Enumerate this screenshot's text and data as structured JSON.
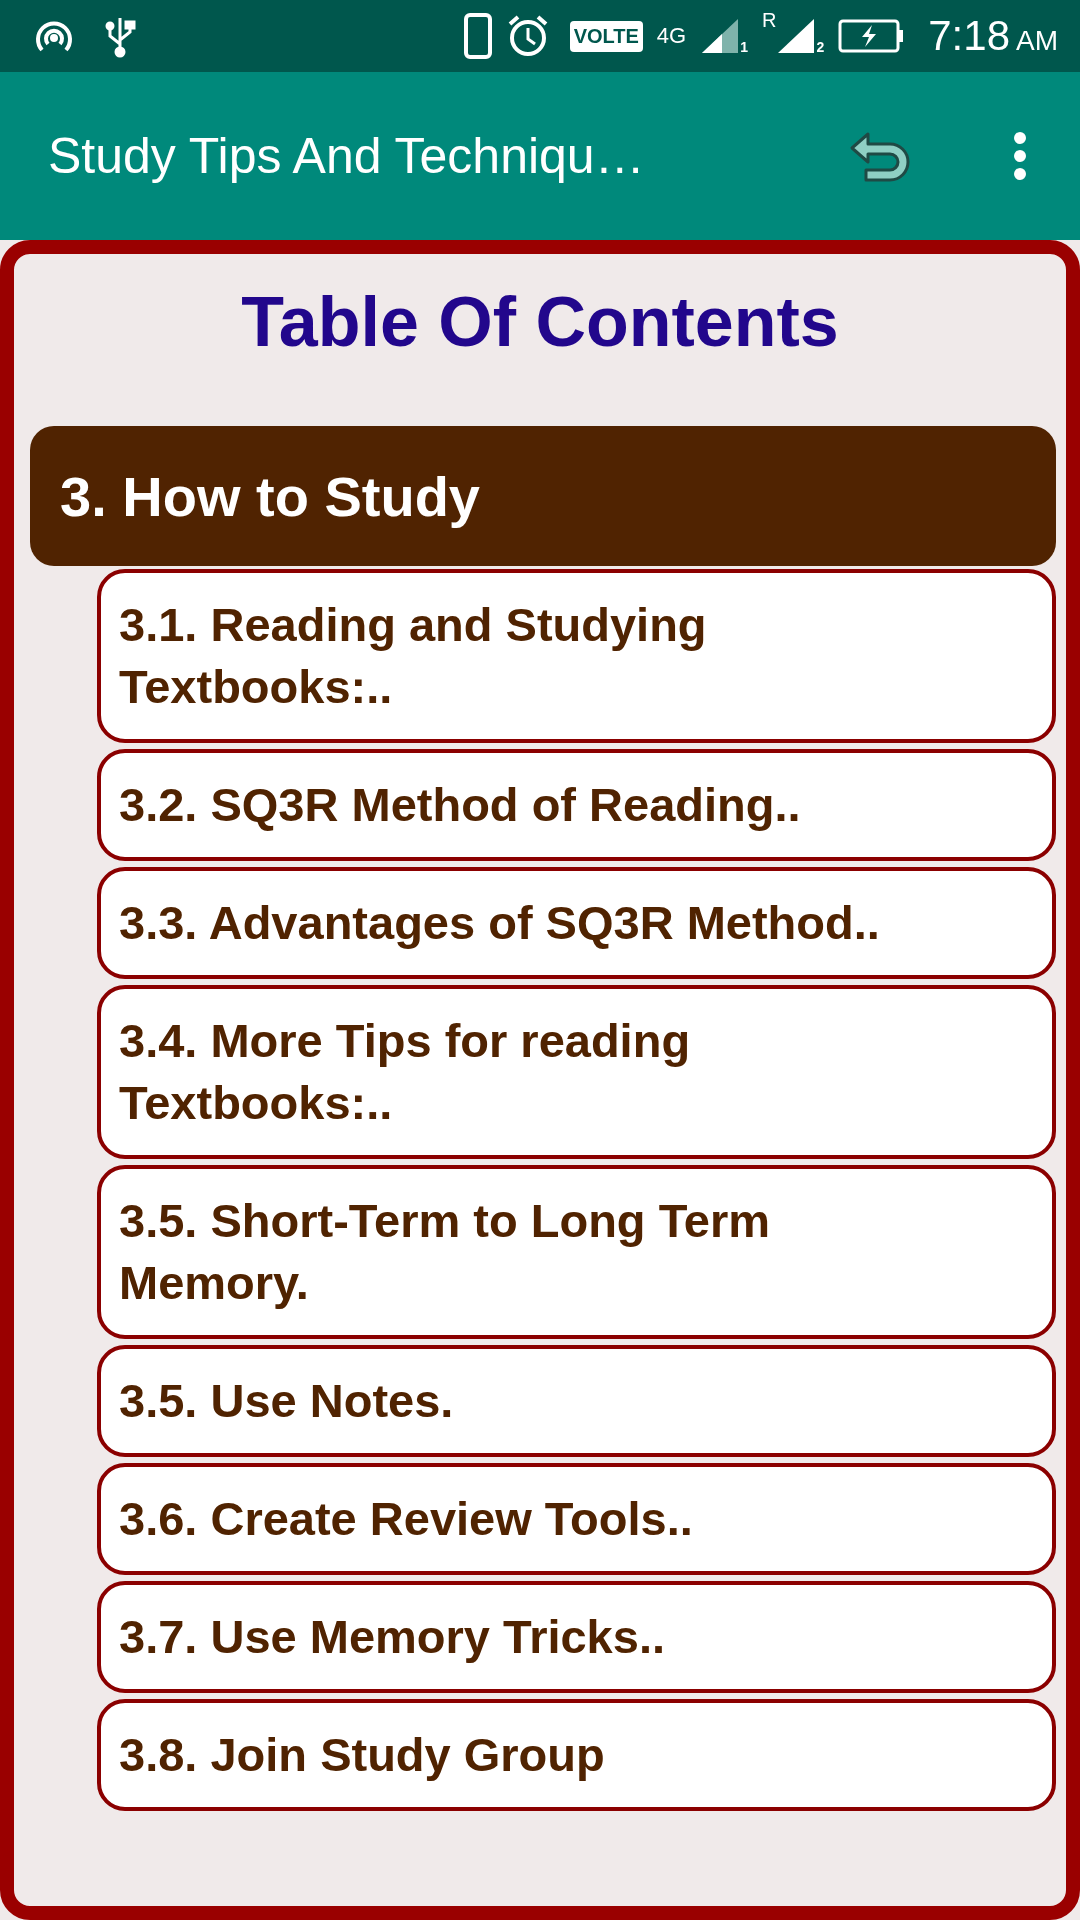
{
  "status_bar": {
    "volte": "VOLTE",
    "network": "4G",
    "sim1": "1",
    "roaming": "R",
    "sim2": "2",
    "time": "7:18",
    "ampm": "AM"
  },
  "app_bar": {
    "title": "Study Tips And Techniqu…"
  },
  "page": {
    "heading": "Table Of Contents",
    "section": {
      "title": "3. How to Study"
    },
    "items": [
      {
        "label": "3.1. Reading and Studying Textbooks:.."
      },
      {
        "label": "3.2. SQ3R Method of Reading.."
      },
      {
        "label": "3.3. Advantages of SQ3R Method.."
      },
      {
        "label": "3.4. More Tips for reading Textbooks:.."
      },
      {
        "label": "3.5. Short-Term to Long Term Memory."
      },
      {
        "label": "3.5. Use Notes."
      },
      {
        "label": "3.6. Create Review Tools.."
      },
      {
        "label": "3.7. Use Memory Tricks.."
      },
      {
        "label": "3.8.  Join Study Group"
      }
    ]
  }
}
